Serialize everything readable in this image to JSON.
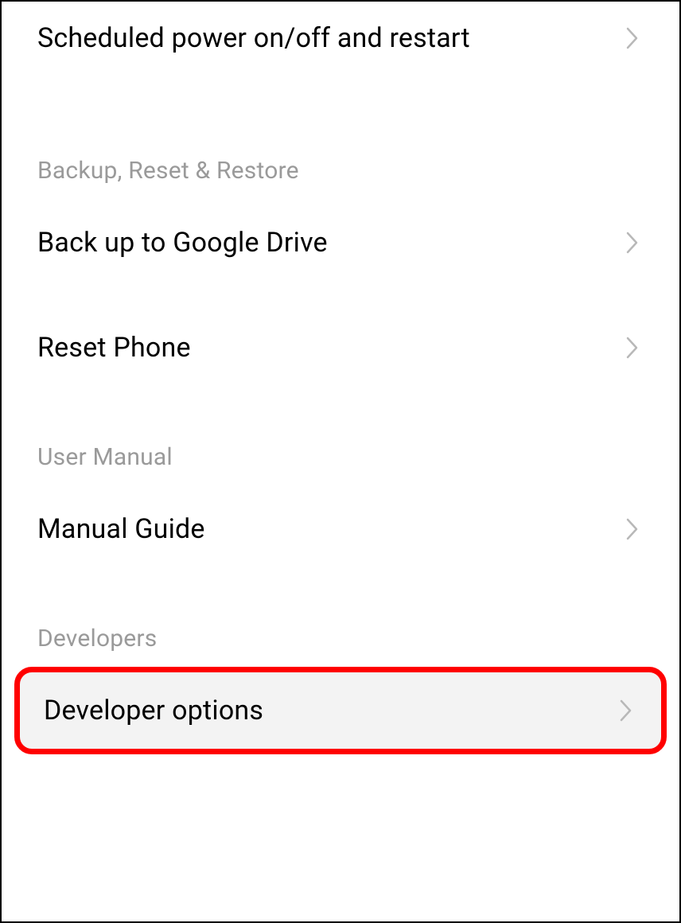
{
  "rows": {
    "scheduled_power": "Scheduled power on/off and restart",
    "backup_google": "Back up to Google Drive",
    "reset_phone": "Reset Phone",
    "manual_guide": "Manual Guide",
    "developer_options": "Developer options"
  },
  "sections": {
    "backup": "Backup, Reset & Restore",
    "user_manual": "User Manual",
    "developers": "Developers"
  }
}
